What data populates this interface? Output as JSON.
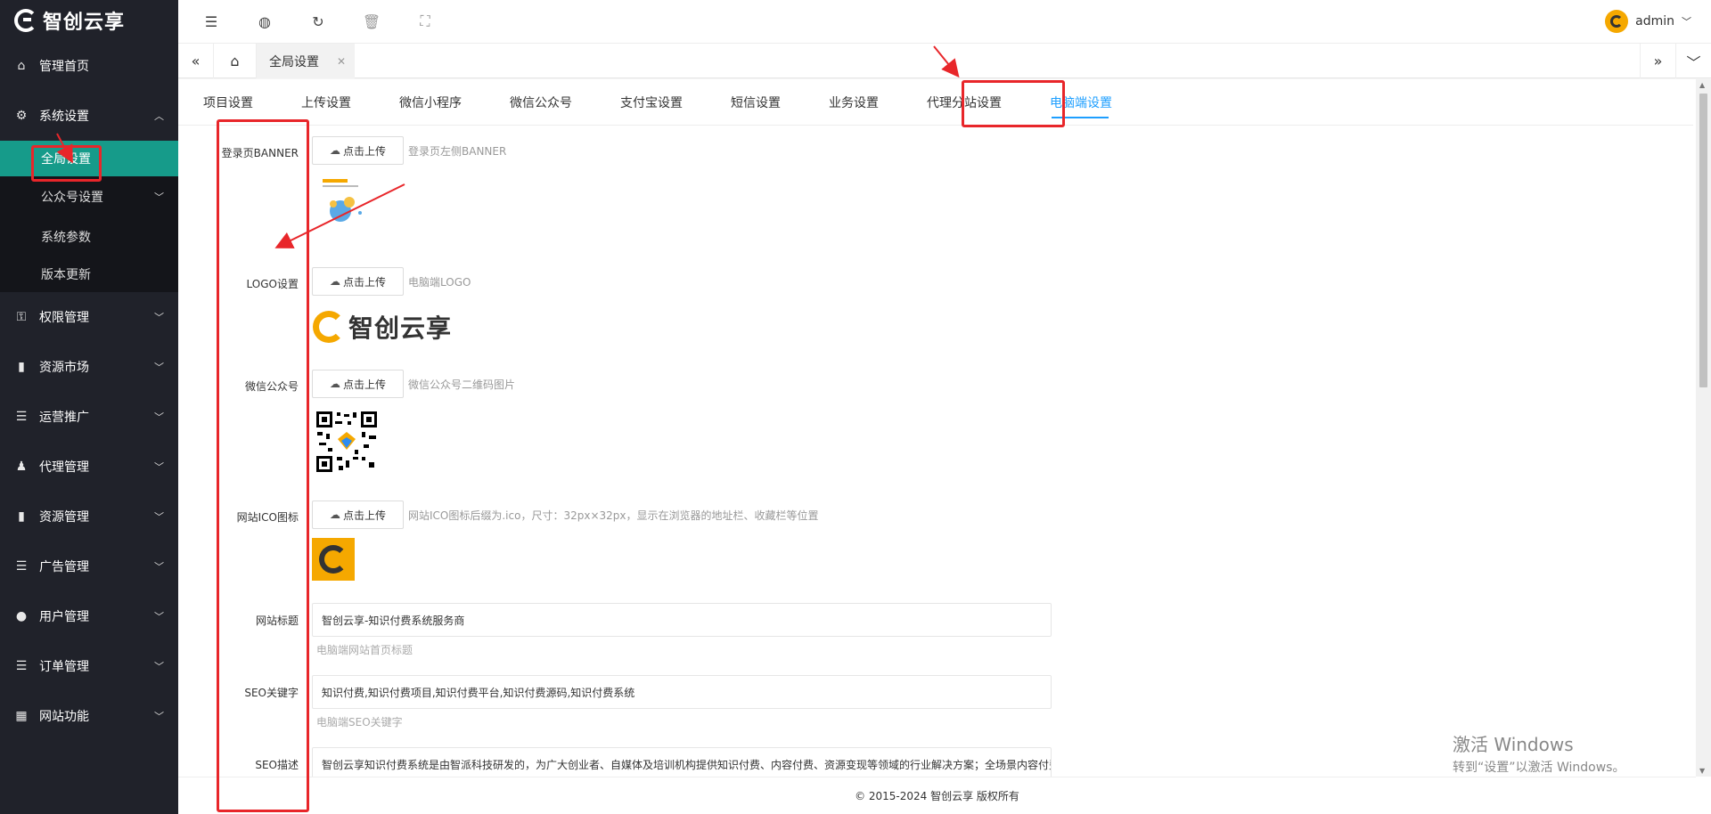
{
  "brand": {
    "name": "智创云享"
  },
  "sidebar": {
    "items": [
      {
        "label": "管理首页",
        "icon": "home-icon"
      },
      {
        "label": "系统设置",
        "icon": "gear-icon"
      },
      {
        "label": "权限管理",
        "icon": "permission-icon"
      },
      {
        "label": "资源市场",
        "icon": "book-icon"
      },
      {
        "label": "运营推广",
        "icon": "list-icon"
      },
      {
        "label": "代理管理",
        "icon": "agent-icon"
      },
      {
        "label": "资源管理",
        "icon": "book-icon"
      },
      {
        "label": "广告管理",
        "icon": "list-icon"
      },
      {
        "label": "用户管理",
        "icon": "user-icon"
      },
      {
        "label": "订单管理",
        "icon": "list-icon"
      },
      {
        "label": "网站功能",
        "icon": "grid-icon"
      }
    ],
    "sub_items": [
      {
        "label": "全局设置"
      },
      {
        "label": "公众号设置"
      },
      {
        "label": "系统参数"
      },
      {
        "label": "版本更新"
      }
    ]
  },
  "header": {
    "user": "admin"
  },
  "tabbar": {
    "current_tab": "全局设置"
  },
  "subtabs": [
    "项目设置",
    "上传设置",
    "微信小程序",
    "微信公众号",
    "支付宝设置",
    "短信设置",
    "业务设置",
    "代理分站设置",
    "电脑端设置"
  ],
  "form": {
    "upload_label": "点击上传",
    "banner": {
      "label": "登录页BANNER",
      "hint": "登录页左侧BANNER"
    },
    "logo": {
      "label": "LOGO设置",
      "hint": "电脑端LOGO",
      "logo_text": "智创云享"
    },
    "wechat": {
      "label": "微信公众号",
      "hint": "微信公众号二维码图片"
    },
    "ico": {
      "label": "网站ICO图标",
      "hint": "网站ICO图标后缀为.ico，尺寸：32px×32px，显示在浏览器的地址栏、收藏栏等位置"
    },
    "site_title": {
      "label": "网站标题",
      "value": "智创云享-知识付费系统服务商",
      "hint": "电脑端网站首页标题"
    },
    "seo_keywords": {
      "label": "SEO关键字",
      "value": "知识付费,知识付费项目,知识付费平台,知识付费源码,知识付费系统",
      "hint": "电脑端SEO关键字"
    },
    "seo_desc": {
      "label": "SEO描述",
      "value": "智创云享知识付费系统是由智派科技研发的，为广大创业者、自媒体及培训机构提供知识付费、内容付费、资源变现等领域的行业解决方案；全场景内容付费"
    }
  },
  "footer": {
    "text": "© 2015-2024 智创云享 版权所有"
  },
  "watermark": {
    "line1": "激活 Windows",
    "line2": "转到“设置”以激活 Windows。"
  },
  "colors": {
    "sidebar_bg": "#20222a",
    "active_green": "#169b8a",
    "accent_blue": "#1e9fff",
    "annotation_red": "#e8262a",
    "logo_orange": "#f5a800"
  }
}
